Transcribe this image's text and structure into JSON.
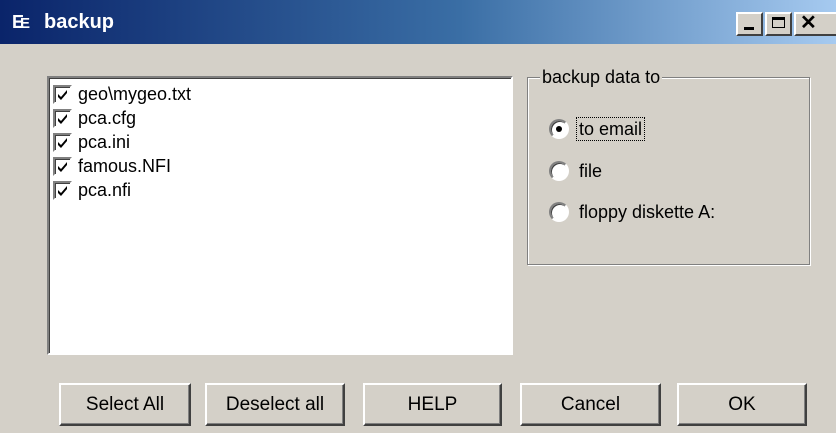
{
  "window": {
    "title": "backup",
    "icon": "app-ee-icon",
    "controls": [
      "minimize-icon",
      "maximize-icon",
      "close-icon"
    ]
  },
  "file_list": {
    "items": [
      {
        "label": "geo\\mygeo.txt",
        "checked": true
      },
      {
        "label": "pca.cfg",
        "checked": true
      },
      {
        "label": "pca.ini",
        "checked": true
      },
      {
        "label": "famous.NFI",
        "checked": true
      },
      {
        "label": "pca.nfi",
        "checked": true
      }
    ]
  },
  "backup_target": {
    "legend": "backup data to",
    "options": [
      {
        "label": "to email",
        "selected": true
      },
      {
        "label": "file",
        "selected": false
      },
      {
        "label": "floppy diskette A:",
        "selected": false
      }
    ]
  },
  "buttons": {
    "select_all": "Select All",
    "deselect_all": "Deselect all",
    "help": "HELP",
    "cancel": "Cancel",
    "ok": "OK"
  },
  "colors": {
    "titlebar_start": "#0a246a",
    "titlebar_end": "#a6caf0",
    "face": "#d4d0c8"
  }
}
